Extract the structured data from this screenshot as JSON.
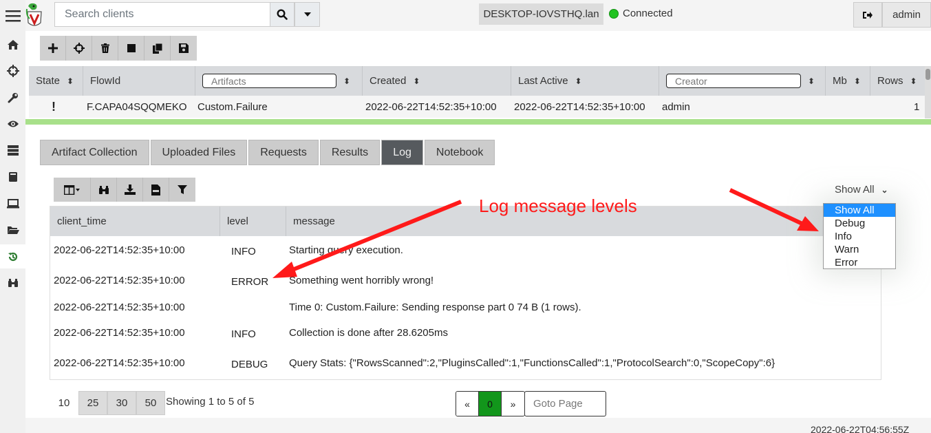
{
  "sidebar": {
    "icons": [
      "menu-icon",
      "home-icon",
      "crosshairs-icon",
      "wrench-icon",
      "eye-icon",
      "server-icon",
      "book-icon",
      "laptop-icon",
      "folder-open-icon",
      "history-icon",
      "binoculars-icon"
    ],
    "active": "history-icon"
  },
  "topbar": {
    "search_placeholder": "Search clients",
    "hostname": "DESKTOP-IOVSTHQ.lan",
    "status": "Connected",
    "user": "admin"
  },
  "flows": {
    "columns": {
      "state": "State",
      "flow_id": "FlowId",
      "artifacts": "Artifacts",
      "created": "Created",
      "last_active": "Last Active",
      "creator": "Creator",
      "mb": "Mb",
      "rows": "Rows"
    },
    "row": {
      "state": "!",
      "flow_id": "F.CAPA04SQQMEKO",
      "artifact": "Custom.Failure",
      "created": "2022-06-22T14:52:35+10:00",
      "last_active": "2022-06-22T14:52:35+10:00",
      "creator": "admin",
      "mb": "",
      "rows": "1"
    }
  },
  "tabs": [
    {
      "label": "Artifact Collection"
    },
    {
      "label": "Uploaded Files"
    },
    {
      "label": "Requests"
    },
    {
      "label": "Results"
    },
    {
      "label": "Log"
    },
    {
      "label": "Notebook"
    }
  ],
  "active_tab": "Log",
  "log": {
    "level_filter": "Show All",
    "level_options": [
      "Show All",
      "Debug",
      "Info",
      "Warn",
      "Error"
    ],
    "columns": {
      "client_time": "client_time",
      "level": "level",
      "message": "message"
    },
    "rows": [
      {
        "time": "2022-06-22T14:52:35+10:00",
        "level": "INFO",
        "message": "Starting query execution."
      },
      {
        "time": "2022-06-22T14:52:35+10:00",
        "level": "ERROR",
        "message": "Something went horribly wrong!"
      },
      {
        "time": "2022-06-22T14:52:35+10:00",
        "level": "",
        "message": "Time 0: Custom.Failure: Sending response part 0 74 B (1 rows)."
      },
      {
        "time": "2022-06-22T14:52:35+10:00",
        "level": "INFO",
        "message": "Collection is done after 28.6205ms"
      },
      {
        "time": "2022-06-22T14:52:35+10:00",
        "level": "DEBUG",
        "message": "Query Stats: {\"RowsScanned\":2,\"PluginsCalled\":1,\"FunctionsCalled\":1,\"ProtocolSearch\":0,\"ScopeCopy\":6}"
      }
    ]
  },
  "pagination": {
    "page_sizes": [
      "10",
      "25",
      "30",
      "50"
    ],
    "showing": "Showing 1 to 5 of 5",
    "prev": "«",
    "current": "0",
    "next": "»",
    "goto_placeholder": "Goto Page"
  },
  "footer_time": "2022-06-22T04:56:55Z",
  "annotation": {
    "text": "Log message levels",
    "color": "#ff1a1a"
  },
  "colors": {
    "accent_green": "#12961b",
    "status_bar": "#a8e08a",
    "selection_blue": "#1e90ff"
  }
}
